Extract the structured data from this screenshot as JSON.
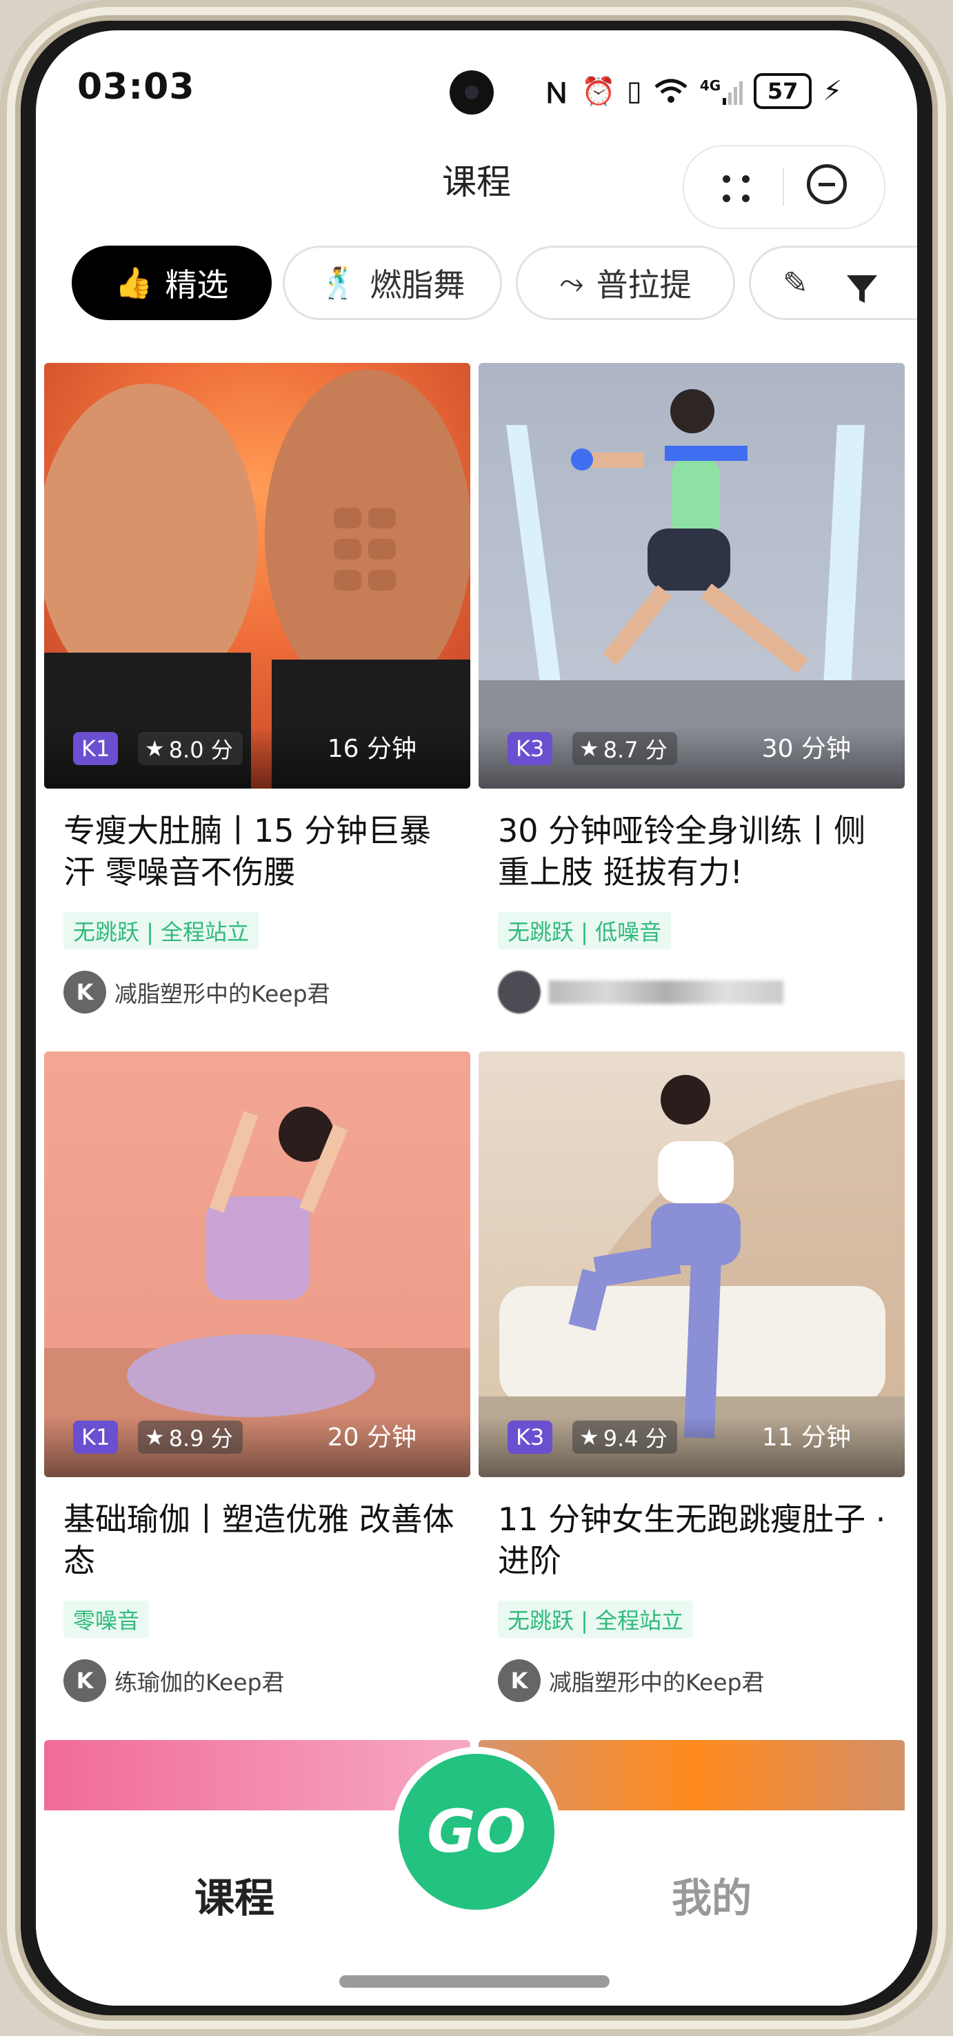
{
  "status_bar": {
    "time": "03:03",
    "battery": "57",
    "icons": [
      "nfc-icon",
      "alarm-icon",
      "vibrate-icon",
      "wifi-icon",
      "4g-signal-icon",
      "battery-icon",
      "charging-icon"
    ],
    "network": "4G"
  },
  "header": {
    "title": "课程"
  },
  "chips": [
    {
      "label": "精选",
      "icon": "thumbs-up-icon",
      "active": true
    },
    {
      "label": "燃脂舞",
      "icon": "dancer-icon",
      "active": false
    },
    {
      "label": "普拉提",
      "icon": "pilates-icon",
      "active": false
    }
  ],
  "cards": [
    {
      "level": "K1",
      "rating": "8.0 分",
      "duration": "16 分钟",
      "title": "专瘦大肚腩丨15 分钟巨暴汗 零噪音不伤腰",
      "tag": "无跳跃 | 全程站立",
      "author_initial": "K",
      "author": "减脂塑形中的Keep君"
    },
    {
      "level": "K3",
      "rating": "8.7 分",
      "duration": "30 分钟",
      "title": "30 分钟哑铃全身训练丨侧重上肢 挺拔有力!",
      "tag": "无跳跃 | 低噪音",
      "author_initial": "",
      "author": ""
    },
    {
      "level": "K1",
      "rating": "8.9 分",
      "duration": "20 分钟",
      "title": "基础瑜伽丨塑造优雅 改善体态",
      "tag": "零噪音",
      "author_initial": "K",
      "author": "练瑜伽的Keep君"
    },
    {
      "level": "K3",
      "rating": "9.4 分",
      "duration": "11 分钟",
      "title": "11 分钟女生无跑跳瘦肚子 · 进阶",
      "tag": "无跳跃 | 全程站立",
      "author_initial": "K",
      "author": "减脂塑形中的Keep君"
    }
  ],
  "bottom_nav": {
    "courses": "课程",
    "go": "GO",
    "mine": "我的"
  },
  "colors": {
    "accent": "#24c281",
    "level_badge": "#6a4fd0",
    "tag_text": "#2fba7a",
    "tag_bg": "#eaf9f1"
  }
}
